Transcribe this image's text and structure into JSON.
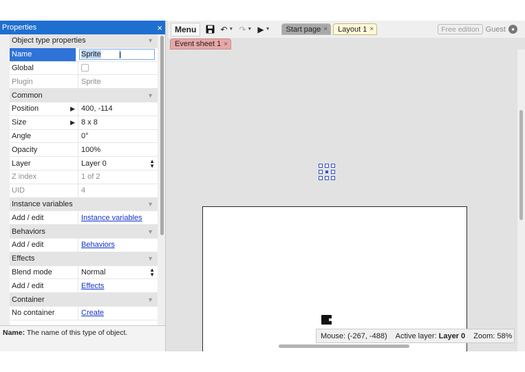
{
  "properties": {
    "title": "Properties",
    "close_label": "×",
    "sections": {
      "object_type": "Object type properties",
      "common": "Common",
      "instance_vars": "Instance variables",
      "behaviors": "Behaviors",
      "effects": "Effects",
      "container": "Container"
    },
    "rows": {
      "name": {
        "label": "Name",
        "value": "Sprite"
      },
      "global": {
        "label": "Global"
      },
      "plugin": {
        "label": "Plugin",
        "value": "Sprite"
      },
      "position": {
        "label": "Position",
        "value": "400, -114"
      },
      "size": {
        "label": "Size",
        "value": "8 x 8"
      },
      "angle": {
        "label": "Angle",
        "value": "0°"
      },
      "opacity": {
        "label": "Opacity",
        "value": "100%"
      },
      "layer": {
        "label": "Layer",
        "value": "Layer 0"
      },
      "zindex": {
        "label": "Z index",
        "value": "1 of 2"
      },
      "uid": {
        "label": "UID",
        "value": "4"
      },
      "instvars_add": {
        "label": "Add / edit",
        "value": "Instance variables"
      },
      "behaviors_add": {
        "label": "Add / edit",
        "value": "Behaviors"
      },
      "blend": {
        "label": "Blend mode",
        "value": "Normal"
      },
      "effects_add": {
        "label": "Add / edit",
        "value": "Effects"
      },
      "container": {
        "label": "No container",
        "value": "Create"
      }
    },
    "description": {
      "term": "Name:",
      "text": " The name of this type of object."
    }
  },
  "toolbar": {
    "menu_label": "Menu",
    "tabs": {
      "start_page": "Start page",
      "layout1": "Layout 1",
      "event_sheet": "Event sheet 1"
    },
    "tab_close": "×",
    "edition": "Free edition",
    "user": "Guest"
  },
  "status": {
    "mouse_label": "Mouse:",
    "mouse_value": "(-267, -488)",
    "layer_label": "Active layer:",
    "layer_value": "Layer 0",
    "zoom_label": "Zoom:",
    "zoom_value": "58%"
  },
  "colors": {
    "accent": "#1e6fd0",
    "selected_row": "#2f73d8",
    "layout_tab": "#fff8d8",
    "event_tab": "#e7a7a7",
    "link": "#1434c8"
  }
}
